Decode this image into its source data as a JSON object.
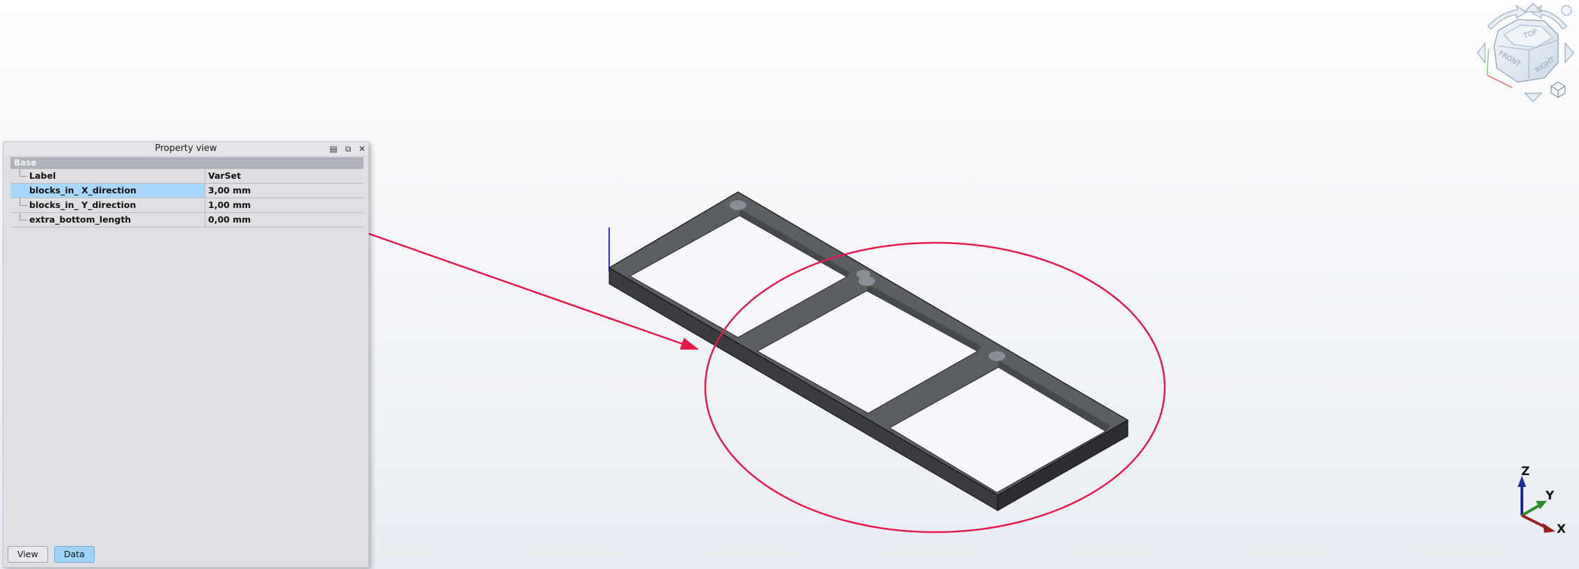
{
  "property_view": {
    "title": "Property view",
    "group": "Base",
    "rows": [
      {
        "name": "Label",
        "value": "VarSet"
      },
      {
        "name": "blocks_in_ X_direction",
        "value": "3,00 mm"
      },
      {
        "name": "blocks_in_ Y_direction",
        "value": "1,00 mm"
      },
      {
        "name": "extra_bottom_length",
        "value": "0,00 mm"
      }
    ],
    "tabs": [
      {
        "label": "View"
      },
      {
        "label": "Data"
      }
    ]
  },
  "nav_cube": {
    "faces": {
      "top": "TOP",
      "front": "FRONT",
      "right": "RIGHT"
    }
  },
  "axis_triad": {
    "x": "X",
    "y": "Y",
    "z": "Z"
  },
  "colors": {
    "annotation": "#e8174a",
    "selection": "#a9d6fb",
    "model": "#3f4145",
    "axis_x": "#9b1c1c",
    "axis_y": "#2a8c2a",
    "axis_z": "#1d2a8f"
  }
}
